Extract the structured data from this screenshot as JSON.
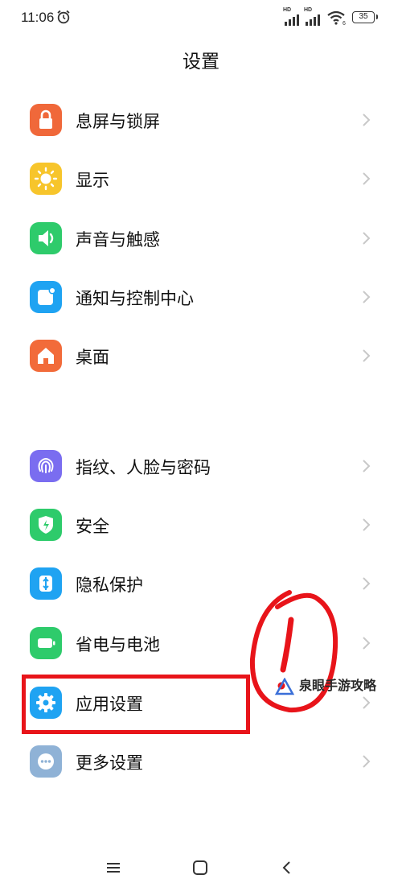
{
  "status_bar": {
    "time": "11:06",
    "signal_1_label": "HD",
    "signal_2_label": "HD",
    "battery_level": "35"
  },
  "header": {
    "title": "设置"
  },
  "groups": [
    {
      "items": [
        {
          "label": "息屏与锁屏",
          "icon": "lock-icon",
          "color": "#f0683a"
        },
        {
          "label": "显示",
          "icon": "sun-icon",
          "color": "#f7c52b"
        },
        {
          "label": "声音与触感",
          "icon": "speaker-icon",
          "color": "#2ecb6b"
        },
        {
          "label": "通知与控制中心",
          "icon": "notification-icon",
          "color": "#1fa3f2"
        },
        {
          "label": "桌面",
          "icon": "home-icon",
          "color": "#f26b3a"
        }
      ]
    },
    {
      "items": [
        {
          "label": "指纹、人脸与密码",
          "icon": "fingerprint-icon",
          "color": "#7a6df0"
        },
        {
          "label": "安全",
          "icon": "shield-icon",
          "color": "#2ecb6b"
        },
        {
          "label": "隐私保护",
          "icon": "privacy-icon",
          "color": "#1fa3f2"
        },
        {
          "label": "省电与电池",
          "icon": "battery-icon",
          "color": "#2ecb6b"
        },
        {
          "label": "应用设置",
          "icon": "gear-icon",
          "color": "#1fa3f2"
        },
        {
          "label": "更多设置",
          "icon": "more-icon",
          "color": "#8fb2d6"
        }
      ]
    }
  ],
  "annotation": {
    "highlight_color": "#e8141a",
    "circled_mark": "!"
  },
  "watermark": {
    "text": "泉眼手游攻略"
  },
  "nav_bar": {
    "menu": "menu-icon",
    "home": "home-square-icon",
    "back": "back-icon"
  }
}
